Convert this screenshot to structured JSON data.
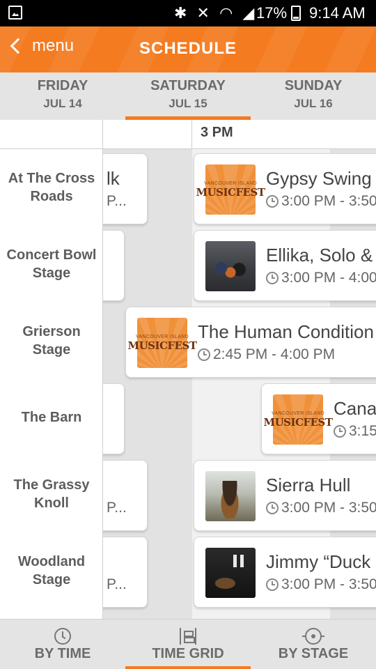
{
  "status_bar": {
    "battery": "17%",
    "time": "9:14 AM"
  },
  "header": {
    "back_label": "menu",
    "title": "SCHEDULE"
  },
  "day_tabs": [
    {
      "day": "FRIDAY",
      "date": "JUL 14"
    },
    {
      "day": "SATURDAY",
      "date": "JUL 15"
    },
    {
      "day": "SUNDAY",
      "date": "JUL 16"
    }
  ],
  "grid": {
    "hour_label": "3 PM",
    "stages": [
      "At The Cross Roads",
      "Concert Bowl Stage",
      "Grierson Stage",
      "The Barn",
      "The Grassy Knoll",
      "Woodland Stage"
    ],
    "fragments": [
      {
        "line1": "lk",
        "line2": "P..."
      },
      {
        "line1": "",
        "line2": ""
      },
      {
        "line1": "",
        "line2": ""
      },
      {
        "line1": "",
        "line2": "P..."
      },
      {
        "line1": "",
        "line2": "P..."
      }
    ],
    "events": [
      {
        "title": "Gypsy Swing",
        "time": "3:00 PM - 3:50"
      },
      {
        "title": "Ellika, Solo & I",
        "time": "3:00 PM - 4:00"
      },
      {
        "title": "The Human Condition",
        "time": "2:45 PM - 4:00 PM"
      },
      {
        "title": "Cana",
        "time": "3:15"
      },
      {
        "title": "Sierra Hull",
        "time": "3:00 PM - 3:50"
      },
      {
        "title": "Jimmy “Duck",
        "time": "3:00 PM - 3:50"
      }
    ],
    "logo": {
      "top": "VANCOUVER ISLAND",
      "main": "MUSICFEST"
    }
  },
  "bottom_nav": [
    {
      "label": "BY TIME",
      "icon": "clock-icon"
    },
    {
      "label": "TIME GRID",
      "icon": "grid-icon"
    },
    {
      "label": "BY STAGE",
      "icon": "target-icon"
    }
  ],
  "colors": {
    "accent": "#f47b20",
    "tab_bg": "#e4e4e4",
    "text_gray": "#6b6b6b"
  }
}
